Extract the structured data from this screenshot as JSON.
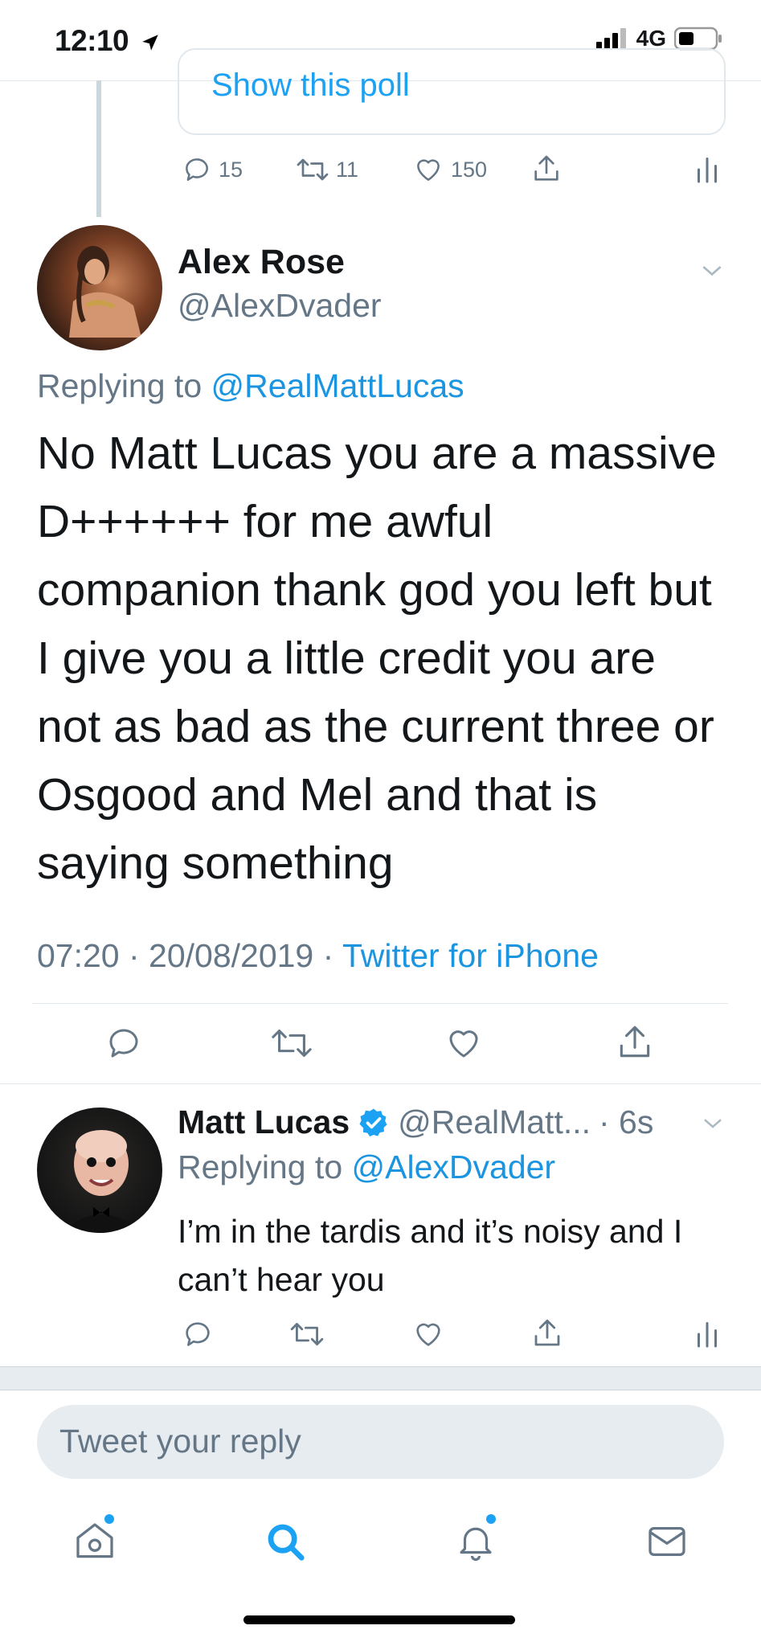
{
  "status_bar": {
    "time": "12:10",
    "network": "4G"
  },
  "previous_tweet": {
    "poll_link": "Show this poll",
    "replies": "15",
    "retweets": "11",
    "likes": "150"
  },
  "main_tweet": {
    "display_name": "Alex Rose",
    "handle": "@AlexDvader",
    "replying_prefix": "Replying to",
    "replying_to": "@RealMattLucas",
    "text": "No Matt Lucas you are a massive D++++++ for me awful companion thank god you left but I give you a little credit you are not as bad as the current three or Osgood and Mel and that is saying something",
    "timestamp": "07:20 · 20/08/2019 ·",
    "source": "Twitter for iPhone"
  },
  "reply_tweet": {
    "display_name": "Matt Lucas",
    "handle": "@RealMatt...",
    "age": "· 6s",
    "replying_prefix": "Replying to",
    "replying_to": "@AlexDvader",
    "text": "I’m in the tardis and it’s noisy and I can’t hear you"
  },
  "composer": {
    "placeholder": "Tweet your reply"
  },
  "tab_bar": {
    "items": [
      "home",
      "search",
      "notifications",
      "messages"
    ]
  },
  "colors": {
    "accent": "#1da1f2",
    "link": "#1b95e0",
    "secondary_text": "#657786",
    "divider": "#e1e8ed"
  }
}
